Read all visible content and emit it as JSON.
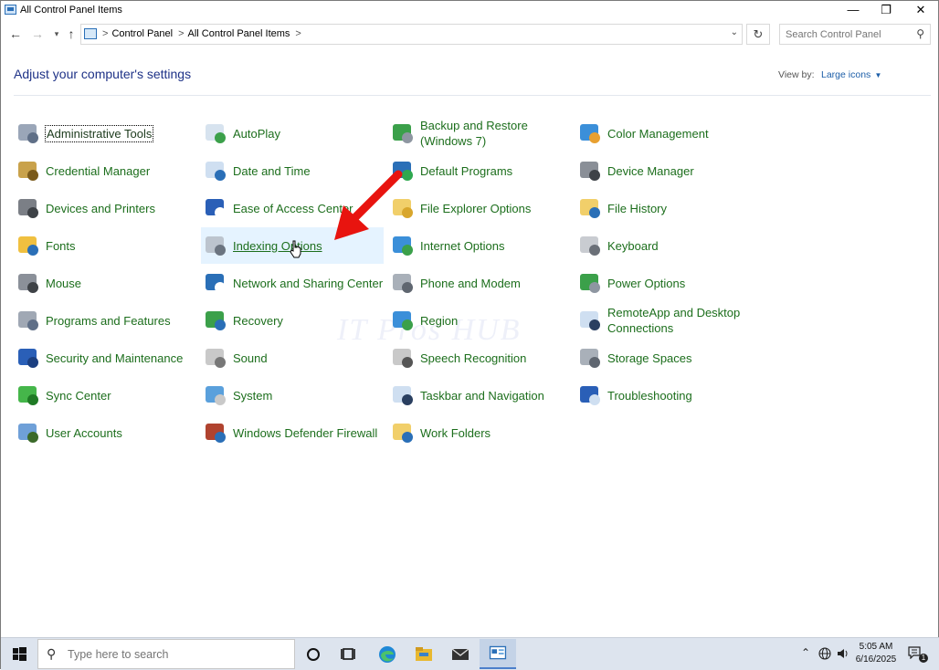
{
  "window": {
    "title": "All Control Panel Items",
    "min_glyph": "—",
    "max_glyph": "❐",
    "close_glyph": "✕"
  },
  "nav": {
    "back_glyph": "←",
    "forward_glyph": "→",
    "recent_glyph": "▾",
    "up_glyph": "↑",
    "breadcrumbs": [
      "Control Panel",
      "All Control Panel Items"
    ],
    "crumb_sep": ">",
    "dropdown_glyph": "⌄",
    "refresh_glyph": "↻"
  },
  "search": {
    "placeholder": "Search Control Panel"
  },
  "header": {
    "heading": "Adjust your computer's settings",
    "view_by_label": "View by:",
    "view_by_value": "Large icons"
  },
  "items": [
    {
      "label": "Administrative Tools",
      "icon": "administrative-tools-icon"
    },
    {
      "label": "Credential Manager",
      "icon": "credential-manager-icon"
    },
    {
      "label": "Devices and Printers",
      "icon": "devices-printers-icon"
    },
    {
      "label": "Fonts",
      "icon": "fonts-icon"
    },
    {
      "label": "Mouse",
      "icon": "mouse-icon"
    },
    {
      "label": "Programs and Features",
      "icon": "programs-features-icon"
    },
    {
      "label": "Security and Maintenance",
      "icon": "security-maintenance-flag-icon"
    },
    {
      "label": "Sync Center",
      "icon": "sync-center-icon"
    },
    {
      "label": "User Accounts",
      "icon": "user-accounts-icon"
    },
    {
      "label": "AutoPlay",
      "icon": "autoplay-icon"
    },
    {
      "label": "Date and Time",
      "icon": "date-time-icon"
    },
    {
      "label": "Ease of Access Center",
      "icon": "ease-of-access-icon"
    },
    {
      "label": "Indexing Options",
      "icon": "indexing-options-icon"
    },
    {
      "label": "Network and Sharing Center",
      "icon": "network-sharing-icon"
    },
    {
      "label": "Recovery",
      "icon": "recovery-icon"
    },
    {
      "label": "Sound",
      "icon": "sound-icon"
    },
    {
      "label": "System",
      "icon": "system-icon"
    },
    {
      "label": "Windows Defender Firewall",
      "icon": "firewall-icon"
    },
    {
      "label": "Backup and Restore (Windows 7)",
      "icon": "backup-restore-icon"
    },
    {
      "label": "Default Programs",
      "icon": "default-programs-icon"
    },
    {
      "label": "File Explorer Options",
      "icon": "file-explorer-options-icon"
    },
    {
      "label": "Internet Options",
      "icon": "internet-options-icon"
    },
    {
      "label": "Phone and Modem",
      "icon": "phone-modem-icon"
    },
    {
      "label": "Region",
      "icon": "region-globe-icon"
    },
    {
      "label": "Speech Recognition",
      "icon": "microphone-icon"
    },
    {
      "label": "Taskbar and Navigation",
      "icon": "taskbar-navigation-icon"
    },
    {
      "label": "Work Folders",
      "icon": "work-folders-icon"
    },
    {
      "label": "Color Management",
      "icon": "color-management-icon"
    },
    {
      "label": "Device Manager",
      "icon": "device-manager-icon"
    },
    {
      "label": "File History",
      "icon": "file-history-icon"
    },
    {
      "label": "Keyboard",
      "icon": "keyboard-icon"
    },
    {
      "label": "Power Options",
      "icon": "power-options-icon"
    },
    {
      "label": "RemoteApp and Desktop Connections",
      "icon": "remoteapp-icon"
    },
    {
      "label": "Storage Spaces",
      "icon": "storage-spaces-icon"
    },
    {
      "label": "Troubleshooting",
      "icon": "troubleshooting-icon"
    }
  ],
  "watermark": "IT Pros HUB",
  "taskbar": {
    "search_placeholder": "Type here to search",
    "time": "5:05 AM",
    "date": "6/16/2025",
    "notification_count": "1"
  },
  "colors": {
    "link_green": "#1c6e1c",
    "heading_blue": "#1e3287",
    "hover_bg": "#e5f3ff",
    "arrow_red": "#e8140f",
    "taskbar_bg": "#dde4ee"
  }
}
